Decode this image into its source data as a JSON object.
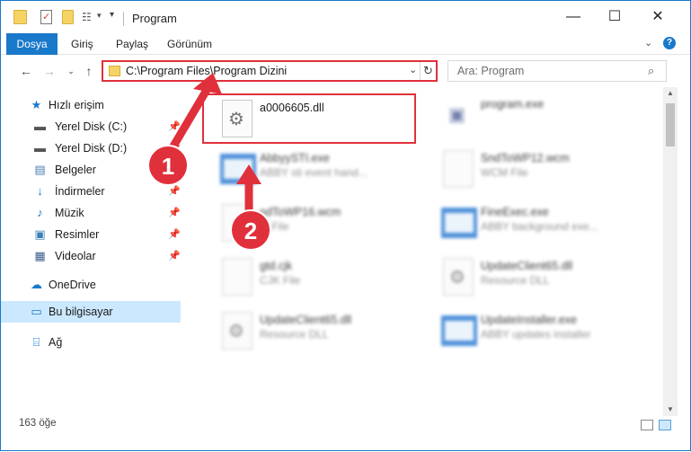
{
  "window": {
    "title": "Program"
  },
  "ribbon": {
    "tabs": [
      {
        "label": "Dosya"
      },
      {
        "label": "Giriş"
      },
      {
        "label": "Paylaş"
      },
      {
        "label": "Görünüm"
      }
    ]
  },
  "address": {
    "path": "C:\\Program Files\\Program Dizini"
  },
  "search": {
    "placeholder": "Ara: Program"
  },
  "sidebar": {
    "items": [
      {
        "label": "Hızlı erişim",
        "icon": "star-icon"
      },
      {
        "label": "Yerel Disk (C:)",
        "icon": "drive-icon",
        "pinned": true
      },
      {
        "label": "Yerel Disk (D:)",
        "icon": "drive-icon",
        "pinned": true
      },
      {
        "label": "Belgeler",
        "icon": "documents-icon",
        "pinned": true
      },
      {
        "label": "İndirmeler",
        "icon": "downloads-icon",
        "pinned": true
      },
      {
        "label": "Müzik",
        "icon": "music-icon",
        "pinned": true
      },
      {
        "label": "Resimler",
        "icon": "pictures-icon",
        "pinned": true
      },
      {
        "label": "Videolar",
        "icon": "videos-icon",
        "pinned": true
      },
      {
        "label": "OneDrive",
        "icon": "onedrive-icon"
      },
      {
        "label": "Bu bilgisayar",
        "icon": "computer-icon",
        "selected": true
      },
      {
        "label": "Ağ",
        "icon": "network-icon"
      }
    ]
  },
  "files": [
    {
      "name": "a0006605.dll",
      "type": ""
    },
    {
      "name": "program.exe",
      "type": ""
    },
    {
      "name": "AbbyySTI.exe",
      "type": "ABBY sti event hand..."
    },
    {
      "name": "SndToWP12.wcm",
      "type": "WCM File"
    },
    {
      "name": "ndToWP16.wcm",
      "type": "M File"
    },
    {
      "name": "FineExec.exe",
      "type": "ABBY background exe..."
    },
    {
      "name": "gtd.cjk",
      "type": "CJK File"
    },
    {
      "name": "UpdateClient65.dll",
      "type": "Resource DLL"
    },
    {
      "name": "UpdateClient65.dll",
      "type": "Resource DLL"
    },
    {
      "name": "UpdateInstaller.exe",
      "type": "ABBY updates installer"
    }
  ],
  "status": {
    "count": "163 öğe"
  },
  "annotations": {
    "step1": "1",
    "step2": "2",
    "color": "#e0303b"
  }
}
